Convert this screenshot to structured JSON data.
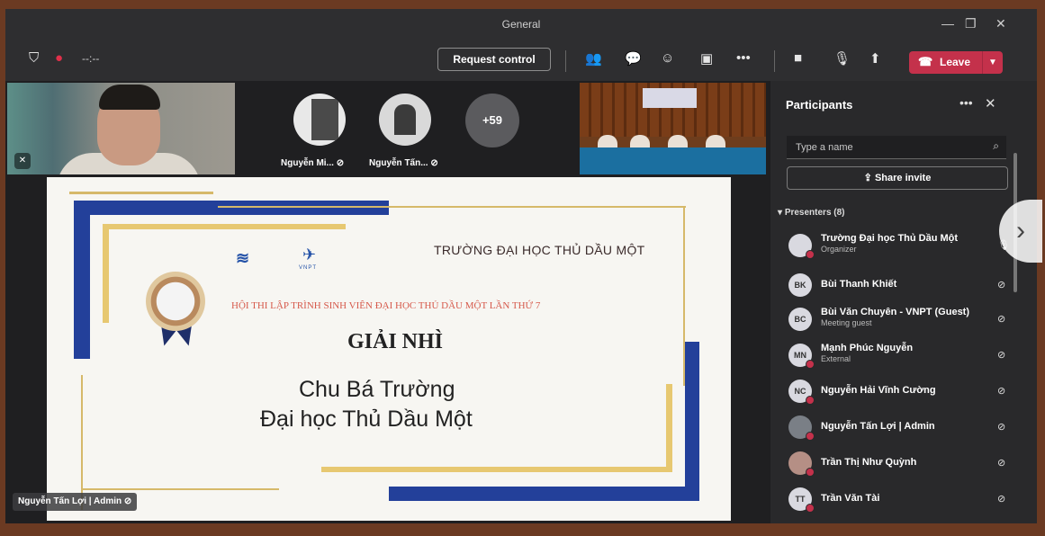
{
  "window": {
    "title": "General"
  },
  "toolbar": {
    "timer": "--:--",
    "request_control": "Request control",
    "leave": "Leave"
  },
  "videos": {
    "avatar1_name": "Nguyễn Mi...",
    "avatar2_name": "Nguyễn Tấn...",
    "more_count": "+59"
  },
  "slide": {
    "school": "TRƯỜNG ĐẠI HỌC THỦ DẦU MỘT",
    "contest": "HỘI THI LẬP TRÌNH SINH VIÊN ĐẠI HỌC THỦ DẦU MỘT LẦN THỨ 7",
    "award": "GIẢI NHÌ",
    "name": "Chu Bá Trường",
    "university": "Đại học Thủ Dầu Một",
    "logo_text": "VNPT"
  },
  "presenter_badge": "Nguyễn Tấn Lợi | Admin",
  "participants": {
    "title": "Participants",
    "search_placeholder": "Type a name",
    "share_invite": "Share invite",
    "section": "Presenters (8)",
    "people": [
      {
        "initials": "",
        "name": "Trường Đại học Thủ Dầu Một",
        "role": "Organizer"
      },
      {
        "initials": "BK",
        "name": "Bùi Thanh Khiết",
        "role": ""
      },
      {
        "initials": "BC",
        "name": "Bùi Văn Chuyên - VNPT (Guest)",
        "role": "Meeting guest"
      },
      {
        "initials": "MN",
        "name": "Mạnh Phúc Nguyễn",
        "role": "External"
      },
      {
        "initials": "NC",
        "name": "Nguyễn Hải Vĩnh Cường",
        "role": ""
      },
      {
        "initials": "",
        "name": "Nguyễn Tấn Lợi | Admin",
        "role": ""
      },
      {
        "initials": "",
        "name": "Trần Thị Như Quỳnh",
        "role": ""
      },
      {
        "initials": "TT",
        "name": "Trần Văn Tài",
        "role": ""
      }
    ]
  }
}
